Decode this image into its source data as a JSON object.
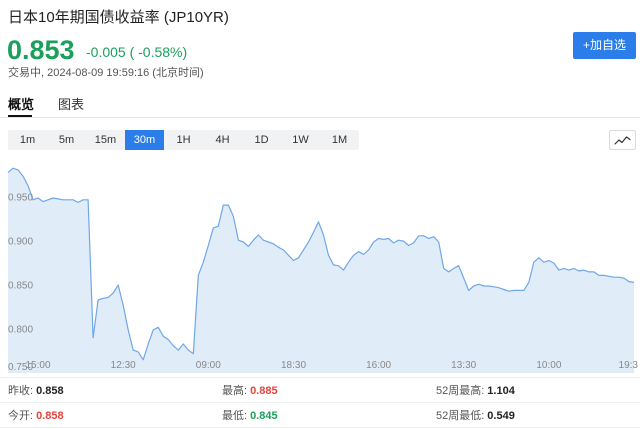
{
  "header": {
    "title": "日本10年期国债收益率 (JP10YR)",
    "price": "0.853",
    "change": "-0.005 ( -0.58%)",
    "tone": "down",
    "status": "交易中, 2024-08-09 19:59:16 (北京时间)",
    "watchlist_button": "+加自选"
  },
  "tabs": [
    {
      "label": "概览",
      "active": true
    },
    {
      "label": "图表",
      "active": false
    }
  ],
  "intervals": {
    "items": [
      {
        "label": "1m",
        "active": false
      },
      {
        "label": "5m",
        "active": false
      },
      {
        "label": "15m",
        "active": false
      },
      {
        "label": "30m",
        "active": true
      },
      {
        "label": "1H",
        "active": false
      },
      {
        "label": "4H",
        "active": false
      },
      {
        "label": "1D",
        "active": false
      },
      {
        "label": "1W",
        "active": false
      },
      {
        "label": "1M",
        "active": false
      }
    ]
  },
  "chart_type_icon": "line-chart-icon",
  "colors": {
    "up": "#e5433b",
    "down": "#1a9f5c",
    "neutral": "#222222",
    "accent": "#2b7de9",
    "chart_line": "#6fa8e8",
    "chart_fill": "#e1ecf9"
  },
  "chart_data": {
    "type": "area",
    "values": [
      0.978,
      0.983,
      0.981,
      0.974,
      0.963,
      0.947,
      0.949,
      0.945,
      0.947,
      0.949,
      0.948,
      0.947,
      0.947,
      0.947,
      0.944,
      0.947,
      0.947,
      0.79,
      0.833,
      0.835,
      0.836,
      0.841,
      0.85,
      0.827,
      0.799,
      0.776,
      0.774,
      0.765,
      0.783,
      0.799,
      0.802,
      0.792,
      0.788,
      0.781,
      0.776,
      0.783,
      0.776,
      0.772,
      0.861,
      0.876,
      0.895,
      0.915,
      0.917,
      0.941,
      0.941,
      0.928,
      0.901,
      0.899,
      0.894,
      0.901,
      0.907,
      0.901,
      0.899,
      0.897,
      0.893,
      0.89,
      0.884,
      0.878,
      0.881,
      0.89,
      0.899,
      0.91,
      0.922,
      0.907,
      0.884,
      0.873,
      0.872,
      0.867,
      0.876,
      0.884,
      0.888,
      0.885,
      0.89,
      0.899,
      0.903,
      0.902,
      0.903,
      0.898,
      0.901,
      0.9,
      0.895,
      0.898,
      0.906,
      0.906,
      0.903,
      0.905,
      0.899,
      0.869,
      0.865,
      0.869,
      0.872,
      0.858,
      0.844,
      0.849,
      0.851,
      0.849,
      0.849,
      0.848,
      0.847,
      0.845,
      0.843,
      0.844,
      0.844,
      0.844,
      0.853,
      0.876,
      0.881,
      0.876,
      0.878,
      0.875,
      0.867,
      0.869,
      0.867,
      0.869,
      0.866,
      0.867,
      0.865,
      0.865,
      0.861,
      0.861,
      0.86,
      0.859,
      0.859,
      0.858,
      0.854,
      0.853
    ],
    "x_ticks": [
      {
        "label": "15:00",
        "index": 6
      },
      {
        "label": "12:30",
        "index": 23
      },
      {
        "label": "09:00",
        "index": 40
      },
      {
        "label": "18:30",
        "index": 57
      },
      {
        "label": "16:00",
        "index": 74
      },
      {
        "label": "13:30",
        "index": 91
      },
      {
        "label": "10:00",
        "index": 108
      },
      {
        "label": "19:3",
        "index": 125
      }
    ],
    "y_ticks": [
      "0.950",
      "0.900",
      "0.850",
      "0.800",
      "0.750"
    ],
    "ylim": [
      0.75,
      0.99
    ],
    "grid": false
  },
  "stats": [
    [
      {
        "label": "昨收:",
        "value": "0.858",
        "tone": "neutral"
      },
      {
        "label": "最高:",
        "value": "0.885",
        "tone": "up"
      },
      {
        "label": "52周最高:",
        "value": "1.104",
        "tone": "neutral"
      }
    ],
    [
      {
        "label": "今开:",
        "value": "0.858",
        "tone": "up"
      },
      {
        "label": "最低:",
        "value": "0.845",
        "tone": "down"
      },
      {
        "label": "52周最低:",
        "value": "0.549",
        "tone": "neutral"
      }
    ]
  ]
}
